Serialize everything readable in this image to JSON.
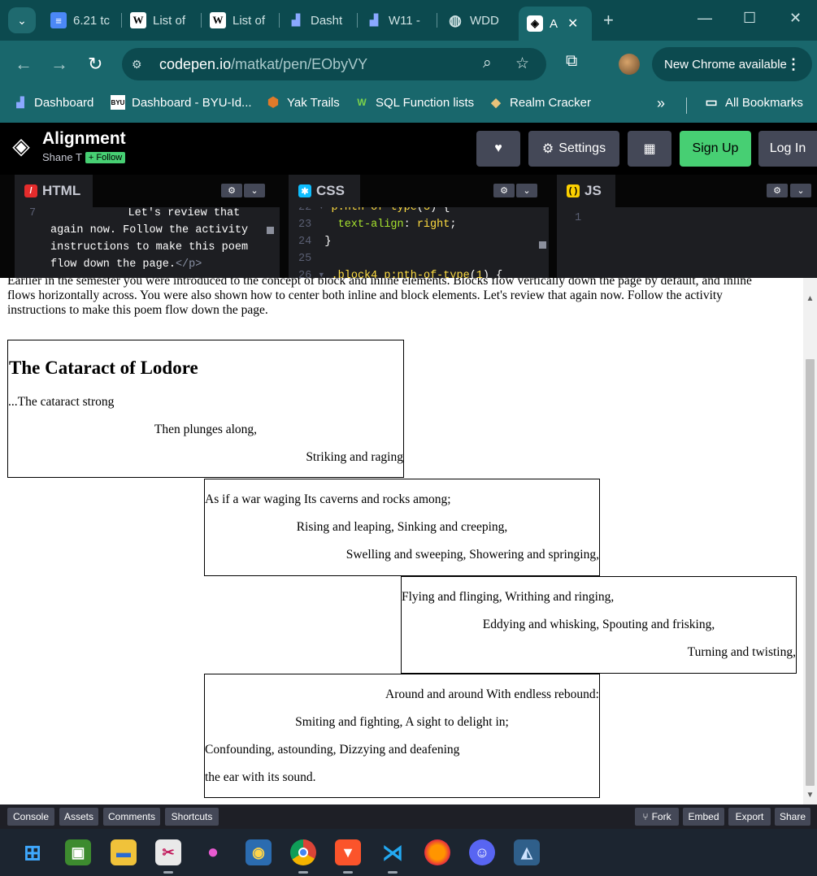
{
  "browser": {
    "tabs": [
      {
        "title": "6.21 tc",
        "favicon": "docs-icon"
      },
      {
        "title": "List of",
        "favicon": "wikipedia-icon"
      },
      {
        "title": "List of",
        "favicon": "wikipedia-icon"
      },
      {
        "title": "Dasht",
        "favicon": "dashboard-icon"
      },
      {
        "title": "W11 -",
        "favicon": "dashboard-icon"
      },
      {
        "title": "WDD",
        "favicon": "globe-icon"
      },
      {
        "title": "A",
        "favicon": "codepen-icon",
        "active": true
      }
    ],
    "url_host": "codepen.io",
    "url_path": "/matkat/pen/EObyVY",
    "update_label": "New Chrome available",
    "bookmarks": [
      {
        "label": "Dashboard",
        "icon": "dashboard-icon"
      },
      {
        "label": "Dashboard - BYU-Id...",
        "icon": "byu-icon"
      },
      {
        "label": "Yak Trails",
        "icon": "yak-icon"
      },
      {
        "label": "SQL Function lists",
        "icon": "w-icon"
      },
      {
        "label": "Realm Cracker",
        "icon": "realm-icon"
      }
    ],
    "all_bookmarks_label": "All Bookmarks"
  },
  "codepen": {
    "title": "Alignment",
    "author": "Shane T",
    "follow_label": "+ Follow",
    "settings_label": "Settings",
    "signup_label": "Sign Up",
    "login_label": "Log In",
    "editors": {
      "html": {
        "label": "HTML",
        "line_no": "7",
        "lines": [
          "Let's review that",
          "again now. Follow the activity",
          "instructions to make this poem",
          "flow down the page."
        ],
        "close_tag": "</p>"
      },
      "css": {
        "label": "CSS",
        "line1_no": "22",
        "line1_sel": "p:nth-of-type",
        "line1_arg": "3",
        "line2_no": "23",
        "line2_prop": "text-align",
        "line2_val": "right",
        "line3_no": "24",
        "line3": "}",
        "line4_no": "25",
        "line5_no": "26",
        "line5_sel": ".block4 p:nth-of-type",
        "line5_arg": "1"
      },
      "js": {
        "label": "JS",
        "line_no": "1"
      }
    },
    "footer": {
      "console": "Console",
      "assets": "Assets",
      "comments": "Comments",
      "shortcuts": "Shortcuts",
      "fork": "Fork",
      "embed": "Embed",
      "export": "Export",
      "share": "Share"
    }
  },
  "preview": {
    "intro_line1": "Earlier in the semester you were introduced to the concept of block and inline elements. Blocks flow vertically down the page by default, and inline",
    "intro_line2": "flows horizontally across. You were also shown how to center both inline and block elements. Let's review that again now. Follow the activity",
    "intro_line3": "instructions to make this poem flow down the page.",
    "poem_title": "The Cataract of Lodore",
    "block1": [
      "...The cataract strong",
      "Then plunges along,",
      "Striking and raging"
    ],
    "block2": [
      "As if a war waging Its caverns and rocks among;",
      "Rising and leaping, Sinking and creeping,",
      "Swelling and sweeping, Showering and springing,"
    ],
    "block3": [
      "Flying and flinging, Writhing and ringing,",
      "Eddying and whisking, Spouting and frisking,",
      "Turning and twisting,"
    ],
    "block4": [
      "Around and around With endless rebound:",
      "Smiting and fighting, A sight to delight in;",
      "Confounding, astounding, Dizzying and deafening",
      "the ear with its sound."
    ]
  },
  "taskbar": [
    "windows-start-icon",
    "minecraft-icon",
    "file-explorer-icon",
    "snipping-tool-icon",
    "paint-icon",
    "game-icon",
    "chrome-icon",
    "brave-icon",
    "vscode-icon",
    "firefox-icon",
    "discord-icon",
    "mysql-icon"
  ]
}
